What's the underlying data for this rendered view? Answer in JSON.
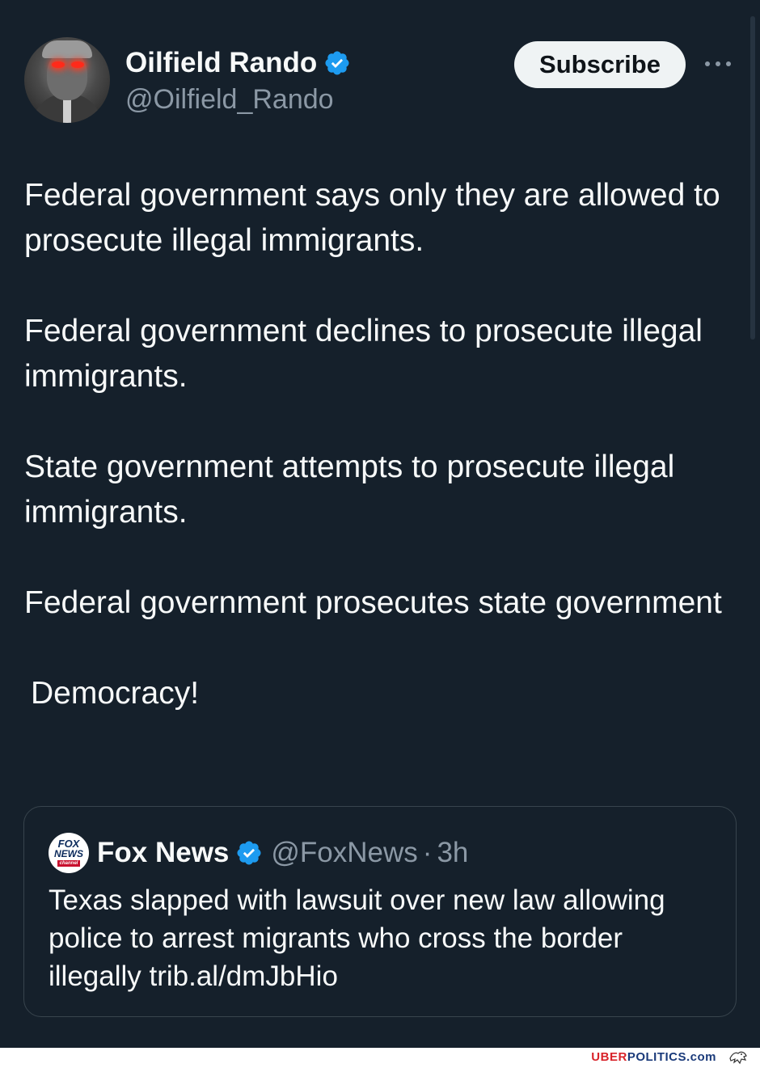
{
  "author": {
    "display_name": "Oilfield Rando",
    "handle": "@Oilfield_Rando",
    "verified_icon": "verified-badge-icon"
  },
  "actions": {
    "subscribe_label": "Subscribe",
    "more_icon": "more-options-icon"
  },
  "tweet": {
    "paragraphs": [
      "Federal government says only they are allowed to prosecute illegal immigrants.",
      "Federal government declines to prosecute illegal immigrants.",
      "State government attempts to prosecute illegal immigrants.",
      "Federal government prosecutes state government",
      "Democracy!"
    ]
  },
  "quoted_tweet": {
    "logo_lines": [
      "FOX",
      "NEWS",
      "channel"
    ],
    "display_name": "Fox News",
    "handle": "@FoxNews",
    "separator": "·",
    "time": "3h",
    "text": "Texas slapped with lawsuit over new law allowing police to arrest migrants who cross the border illegally trib.al/dmJbHio"
  },
  "watermark": {
    "part1": "UBER",
    "part2": "POLITICS",
    "part3": ".com"
  },
  "colors": {
    "background": "#15202b",
    "text": "#f7f9f9",
    "secondary_text": "#8b98a5",
    "verified_blue": "#1d9bf0",
    "button_bg": "#eff3f4"
  }
}
